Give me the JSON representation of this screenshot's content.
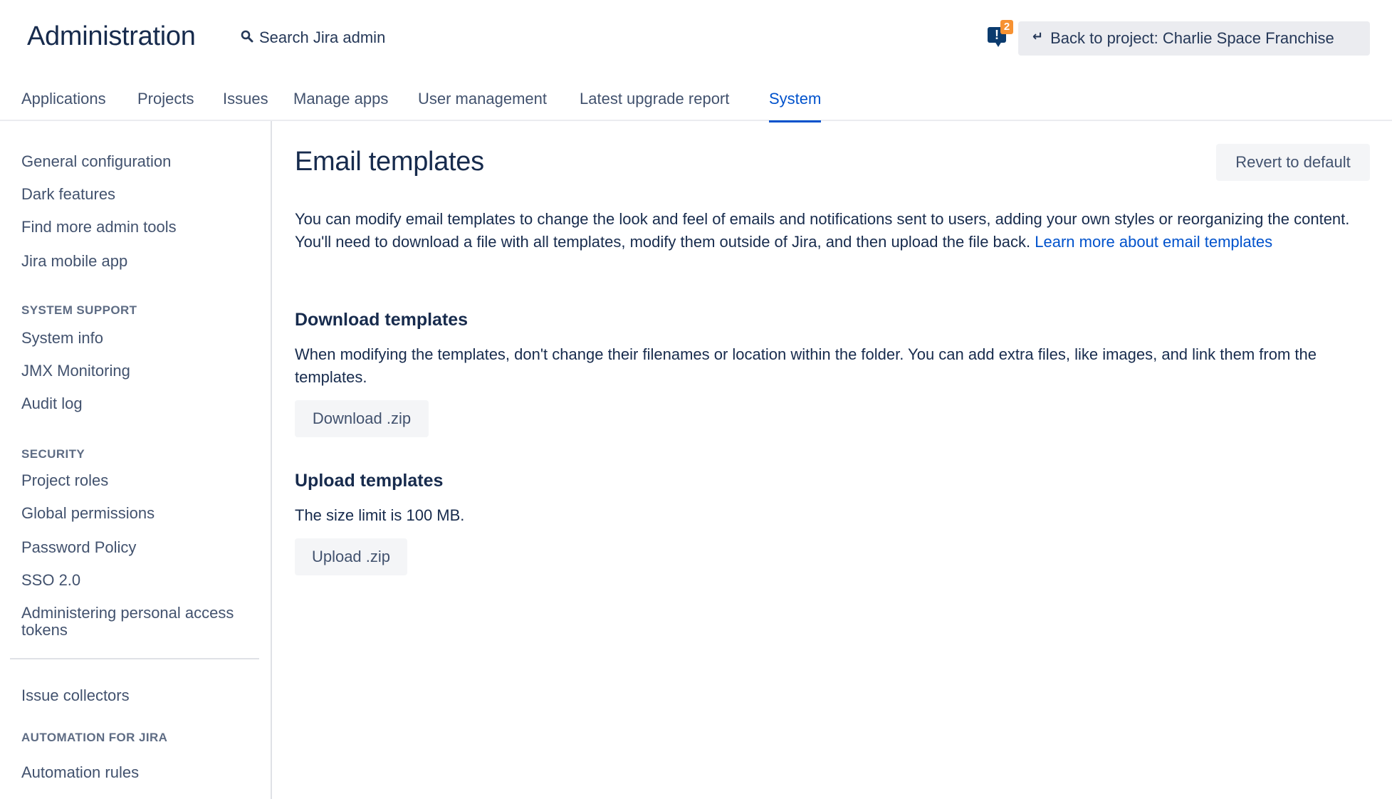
{
  "header": {
    "title": "Administration",
    "search_label": "Search Jira admin",
    "feedback_count": "2",
    "feedback_symbol": "!",
    "back_label": "Back to project: Charlie Space Franchise"
  },
  "tabs": [
    {
      "label": "Applications",
      "active": false
    },
    {
      "label": "Projects",
      "active": false
    },
    {
      "label": "Issues",
      "active": false
    },
    {
      "label": "Manage apps",
      "active": false
    },
    {
      "label": "User management",
      "active": false
    },
    {
      "label": "Latest upgrade report",
      "active": false
    },
    {
      "label": "System",
      "active": true
    }
  ],
  "sidebar": {
    "general": [
      "General configuration",
      "Dark features",
      "Find more admin tools",
      "Jira mobile app"
    ],
    "system_support": {
      "heading": "SYSTEM SUPPORT",
      "items": [
        "System info",
        "JMX Monitoring",
        "Audit log"
      ]
    },
    "security": {
      "heading": "SECURITY",
      "items": [
        "Project roles",
        "Global permissions",
        "Password Policy",
        "SSO 2.0",
        "Administering personal access tokens"
      ]
    },
    "other": [
      "Issue collectors"
    ],
    "automation": {
      "heading": "AUTOMATION FOR JIRA",
      "items": [
        "Automation rules"
      ]
    }
  },
  "main": {
    "title": "Email templates",
    "revert_label": "Revert to default",
    "intro_text": "You can modify email templates to change the look and feel of emails and notifications sent to users, adding your own styles or reorganizing the content. You'll need to download a file with all templates, modify them outside of Jira, and then upload the file back. ",
    "intro_link": "Learn more about email templates",
    "download": {
      "title": "Download templates",
      "text": "When modifying the templates, don't change their filenames or location within the folder. You can add extra files, like images, and link them from the templates.",
      "button": "Download .zip"
    },
    "upload": {
      "title": "Upload templates",
      "text": "The size limit is 100 MB.",
      "button": "Upload .zip"
    }
  },
  "colors": {
    "accent": "#0052cc",
    "text": "#172b4d",
    "muted": "#42526e",
    "badge": "#f79232",
    "button_bg": "#f4f5f7"
  }
}
